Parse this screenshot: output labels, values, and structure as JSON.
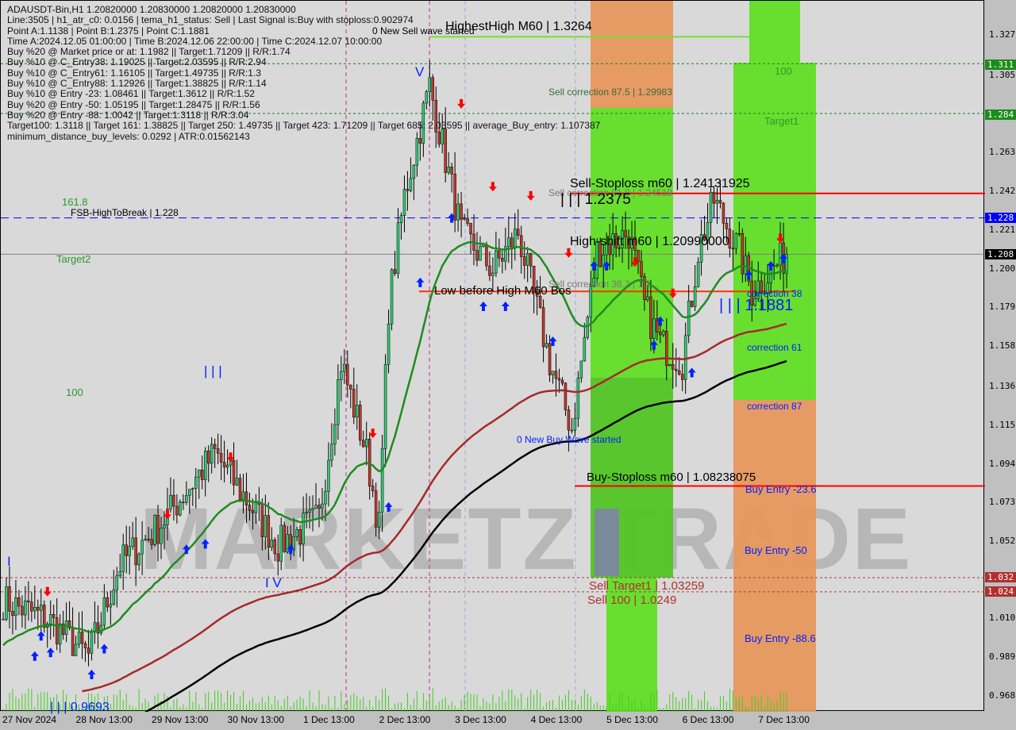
{
  "symbol_header": "ADAUSDT-Bin,H1  1.20820000 1.20830000 1.20820000 1.20830000",
  "info_lines": [
    "Line:3505 | h1_atr_c0: 0.0156 | tema_h1_status: Sell | Last Signal is:Buy with stoploss:0.902974",
    "Point A:1.1138 | Point B:1.2375 | Point C:1.1881",
    "Time A:2024.12.05 01:00:00 | Time B:2024.12.06 22:00:00 | Time C:2024.12.07 10:00:00",
    "Buy %20 @ Market price or at: 1.1982 || Target:1.71209 || R/R:1.74",
    "Buy %10 @ C_Entry38: 1.19025 || Target:2.03595 || R/R:2.94",
    "Buy %10 @ C_Entry61: 1.16105 || Target:1.49735 || R/R:1.3",
    "Buy %10 @ C_Entry88: 1.12926 || Target:1.38825 || R/R:1.14",
    "Buy %10 @ Entry -23: 1.08461 || Target:1.3612 || R/R:1.52",
    "Buy %20 @ Entry -50: 1.05195 || Target:1.28475 || R/R:1.56",
    "Buy %20 @ Entry -88: 1.0042 || Target:1.3118 || R/R:3.04",
    "Target100: 1.3118 || Target 161: 1.38825 || Target 250: 1.49735 || Target 423: 1.71209 || Target 685: 2.03595 || average_Buy_entry: 1.107387",
    "minimum_distance_buy_levels: 0.0292 | ATR:0.01562143"
  ],
  "chart_labels": {
    "highest_high": "HighestHigh   M60 | 1.3264",
    "new_sell_wave": "0 New Sell wave started",
    "wave_v": "V",
    "sell_corr_875": "Sell correction 87.5 | 1.29983",
    "zone_100": "100",
    "target1": "Target1",
    "sell_stoploss": "Sell-Stoploss m60 | 1.24131925",
    "sell_corr_918": "Sell correction 91.8 | 1.24519",
    "point_b": "| | | 1.2375",
    "fib_1618": "161.8",
    "fsb": "FSB-HighToBreak | 1.228",
    "target2": "Target2",
    "high_shift": "High-shift m60 | 1.20990000",
    "sell_corr_382": "Sell correction 38.2 | 1.1...",
    "low_before_high": "Low before High   M60 Bos",
    "point_c": "| | | 1.1881",
    "corr38": "correction 38",
    "corr61": "correction 61",
    "corr87": "correction 87",
    "wave_iii": "| | |",
    "left_100": "100",
    "new_buy_wave": "0 New Buy Wave started",
    "buy_stoploss": "Buy-Stoploss m60 | 1.08238075",
    "buy_entry_236": "Buy Entry -23.6",
    "buy_entry_50": "Buy Entry -50",
    "buy_entry_886": "Buy Entry -88.6",
    "wave_iv": "I V",
    "sell_target1": "Sell Target1 | 1.03259",
    "sell_100": "Sell 100 | 1.0249",
    "low_point": "| | | 0.9693",
    "wave_i": "I"
  },
  "watermark": "MARKETZ TRADE",
  "colors": {
    "bull": "#2ecc71",
    "bear": "#c0392b",
    "ema_fast": "#1e8c1e",
    "ema_mid": "#a52a2a",
    "ema_slow": "#000000",
    "zone_green": "#5ee020",
    "zone_orange": "#e8965a",
    "buy_arrow": "#0022ff",
    "sell_arrow": "#ff0000"
  },
  "chart_data": {
    "type": "candlestick",
    "timeframe": "H1",
    "ylim": [
      0.96,
      1.335
    ],
    "price_ticks": [
      "1.327",
      "1.305",
      "1.263",
      "1.242",
      "1.221",
      "1.200",
      "1.179",
      "1.158",
      "1.136",
      "1.115",
      "1.094",
      "1.073",
      "1.052",
      "1.010",
      "0.989",
      "0.968"
    ],
    "price_labels": [
      {
        "text": "1.311",
        "value": 1.311,
        "color": "#1a8c1a"
      },
      {
        "text": "1.284",
        "value": 1.284,
        "color": "#1a8c1a"
      },
      {
        "text": "1.228",
        "value": 1.228,
        "color": "#0000ff"
      },
      {
        "text": "1.208",
        "value": 1.208,
        "color": "#000000"
      },
      {
        "text": "1.032",
        "value": 1.0326,
        "color": "#b03030"
      },
      {
        "text": "1.024",
        "value": 1.0249,
        "color": "#b03030"
      }
    ],
    "date_ticks": [
      {
        "text": "27 Nov 2024",
        "t": "2024-11-27T13:00"
      },
      {
        "text": "28 Nov 13:00",
        "t": "2024-11-28T13:00"
      },
      {
        "text": "29 Nov 13:00",
        "t": "2024-11-29T13:00"
      },
      {
        "text": "30 Nov 13:00",
        "t": "2024-11-30T13:00"
      },
      {
        "text": "1 Dec 13:00",
        "t": "2024-12-01T13:00"
      },
      {
        "text": "2 Dec 13:00",
        "t": "2024-12-02T13:00"
      },
      {
        "text": "3 Dec 13:00",
        "t": "2024-12-03T13:00"
      },
      {
        "text": "4 Dec 13:00",
        "t": "2024-12-04T13:00"
      },
      {
        "text": "5 Dec 13:00",
        "t": "2024-12-05T13:00"
      },
      {
        "text": "6 Dec 13:00",
        "t": "2024-12-06T13:00"
      },
      {
        "text": "7 Dec 13:00",
        "t": "2024-12-07T13:00"
      }
    ],
    "close_path": [
      [
        "2024-11-27T13:00",
        1.02
      ],
      [
        "2024-11-28T03:00",
        1.01
      ],
      [
        "2024-11-28T16:00",
        0.99
      ],
      [
        "2024-11-29T02:00",
        1.04
      ],
      [
        "2024-11-29T14:00",
        1.06
      ],
      [
        "2024-11-30T08:00",
        1.1
      ],
      [
        "2024-11-30T16:00",
        1.08
      ],
      [
        "2024-12-01T04:00",
        1.05
      ],
      [
        "2024-12-01T17:00",
        1.065
      ],
      [
        "2024-12-02T00:00",
        1.15
      ],
      [
        "2024-12-02T08:00",
        1.1
      ],
      [
        "2024-12-02T12:00",
        1.06
      ],
      [
        "2024-12-02T15:00",
        1.18
      ],
      [
        "2024-12-02T20:00",
        1.24
      ],
      [
        "2024-12-03T04:00",
        1.3
      ],
      [
        "2024-12-03T09:00",
        1.26
      ],
      [
        "2024-12-03T14:00",
        1.22
      ],
      [
        "2024-12-04T00:00",
        1.2
      ],
      [
        "2024-12-04T08:00",
        1.22
      ],
      [
        "2024-12-04T18:00",
        1.15
      ],
      [
        "2024-12-05T01:00",
        1.1138
      ],
      [
        "2024-12-05T09:00",
        1.21
      ],
      [
        "2024-12-05T19:00",
        1.22
      ],
      [
        "2024-12-06T00:00",
        1.18
      ],
      [
        "2024-12-06T05:00",
        1.16
      ],
      [
        "2024-12-06T12:00",
        1.15
      ],
      [
        "2024-12-06T17:00",
        1.21
      ],
      [
        "2024-12-06T22:00",
        1.2375
      ],
      [
        "2024-12-07T06:00",
        1.21
      ],
      [
        "2024-12-07T10:00",
        1.1881
      ],
      [
        "2024-12-07T21:00",
        1.2083
      ]
    ],
    "buy_signals": [
      [
        "2024-11-27T23:00",
        0.99
      ],
      [
        "2024-11-28T04:00",
        0.992
      ],
      [
        "2024-11-28T01:00",
        1.001
      ],
      [
        "2024-11-28T17:00",
        0.98
      ],
      [
        "2024-11-28T21:00",
        0.994
      ],
      [
        "2024-11-29T23:00",
        1.048
      ],
      [
        "2024-11-30T05:00",
        1.051
      ],
      [
        "2024-12-01T08:00",
        1.048
      ],
      [
        "2024-12-02T15:00",
        1.071
      ],
      [
        "2024-12-03T01:00",
        1.193
      ],
      [
        "2024-12-03T11:00",
        1.228
      ],
      [
        "2024-12-03T21:00",
        1.18
      ],
      [
        "2024-12-04T04:00",
        1.18
      ],
      [
        "2024-12-04T19:00",
        1.161
      ],
      [
        "2024-12-05T08:00",
        1.202
      ],
      [
        "2024-12-05T12:00",
        1.202
      ],
      [
        "2024-12-06T03:00",
        1.159
      ],
      [
        "2024-12-06T05:00",
        1.172
      ],
      [
        "2024-12-06T15:00",
        1.144
      ],
      [
        "2024-12-07T09:00",
        1.197
      ],
      [
        "2024-12-07T16:00",
        1.202
      ],
      [
        "2024-12-07T20:00",
        1.206
      ]
    ],
    "sell_signals": [
      [
        "2024-11-28T03:00",
        1.025
      ],
      [
        "2024-11-29T17:00",
        1.067
      ],
      [
        "2024-11-30T13:00",
        1.098
      ],
      [
        "2024-12-02T10:00",
        1.111
      ],
      [
        "2024-12-03T14:00",
        1.29
      ],
      [
        "2024-12-04T00:00",
        1.245
      ],
      [
        "2024-12-04T12:00",
        1.24
      ],
      [
        "2024-12-05T00:00",
        1.209
      ],
      [
        "2024-12-05T21:00",
        1.204
      ],
      [
        "2024-12-06T09:00",
        1.187
      ],
      [
        "2024-12-07T19:00",
        1.217
      ]
    ],
    "levels": [
      {
        "name": "highest-high",
        "value": 1.3264,
        "color": "#7ddc3a"
      },
      {
        "name": "target-100",
        "value": 1.3118,
        "color": "#1a7a1a",
        "dash": true
      },
      {
        "name": "target1",
        "value": 1.28475,
        "color": "#1a7a1a",
        "dash": true
      },
      {
        "name": "sell-stoploss",
        "value": 1.24131925,
        "color": "#ff0000"
      },
      {
        "name": "fsb-high-to-break",
        "value": 1.228,
        "color": "#0000ff",
        "dash": true
      },
      {
        "name": "current-price",
        "value": 1.2083,
        "color": "#808080"
      },
      {
        "name": "low-before-high",
        "value": 1.1881,
        "color": "#ff3300"
      },
      {
        "name": "buy-stoploss",
        "value": 1.08238075,
        "color": "#ff0000"
      },
      {
        "name": "sell-target1",
        "value": 1.03259,
        "color": "#a04040",
        "dash": true
      },
      {
        "name": "sell-100",
        "value": 1.0249,
        "color": "#a04040",
        "dash": true
      }
    ]
  }
}
